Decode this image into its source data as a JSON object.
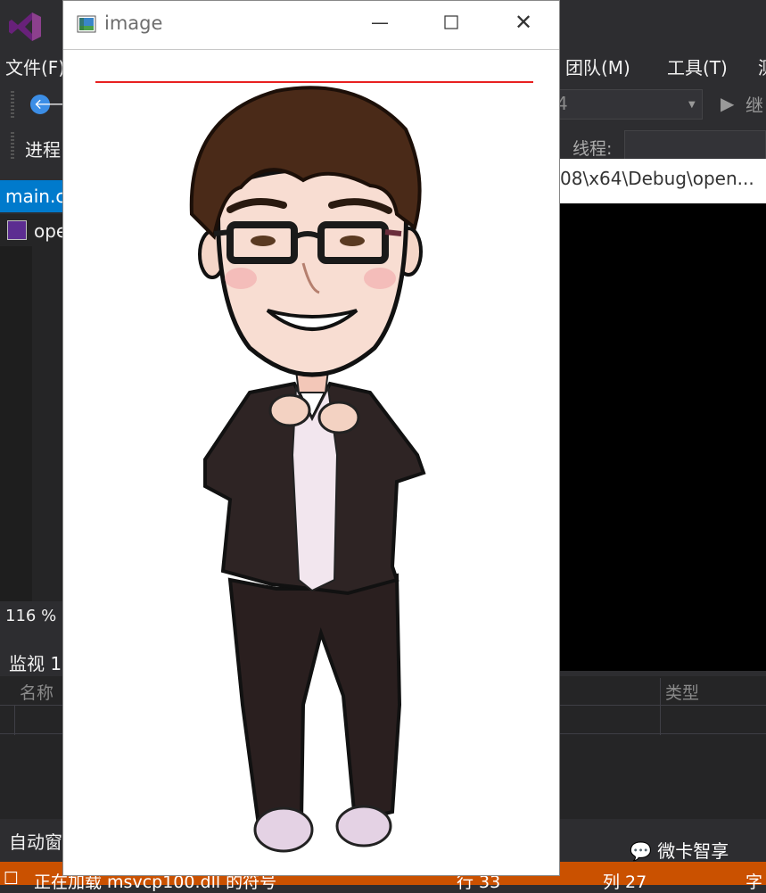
{
  "vs": {
    "menu": [
      "文件(F)",
      "团队(M)",
      "工具(T)",
      "测"
    ],
    "toolbar": {
      "process_label": "进程",
      "combo_text": "4",
      "continue_label": "继",
      "thread_label": "线程:"
    },
    "editor": {
      "tab_label": "main.c",
      "file_label": "ope",
      "zoom": "116 %"
    },
    "watch": {
      "title": "监视 1",
      "col_name": "名称",
      "col_type": "类型"
    },
    "autos_label": "自动窗",
    "status": {
      "message": "正在加载 msvcp100.dll 的符号",
      "line": "行 33",
      "col": "列 27",
      "char": "字"
    }
  },
  "console": {
    "title": "08\\x64\\Debug\\open..."
  },
  "image_window": {
    "title": "image"
  },
  "watermark": "微卡智享",
  "colors": {
    "vs_bg": "#2d2d30",
    "accent_blue": "#007acc",
    "status_orange": "#ca5100",
    "red_line": "#e82020"
  }
}
